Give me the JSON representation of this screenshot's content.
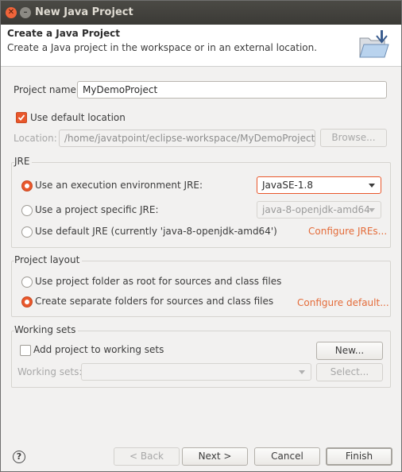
{
  "window": {
    "title": "New Java Project"
  },
  "banner": {
    "title": "Create a Java Project",
    "description": "Create a Java project in the workspace or in an external location.",
    "icon": "folder-wizard-icon"
  },
  "project_name": {
    "label": "Project name:",
    "value": "MyDemoProject"
  },
  "use_default_location": {
    "label": "Use default location",
    "checked": true
  },
  "location": {
    "label": "Location:",
    "value": "/home/javatpoint/eclipse-workspace/MyDemoProject",
    "browse_label": "Browse..."
  },
  "jre": {
    "group_title": "JRE",
    "options": [
      {
        "label": "Use an execution environment JRE:",
        "selected": true
      },
      {
        "label": "Use a project specific JRE:",
        "selected": false
      },
      {
        "label": "Use default JRE (currently 'java-8-openjdk-amd64')",
        "selected": false
      }
    ],
    "execution_env_value": "JavaSE-1.8",
    "project_specific_value": "java-8-openjdk-amd64",
    "configure_link": "Configure JREs..."
  },
  "layout": {
    "group_title": "Project layout",
    "options": [
      {
        "label": "Use project folder as root for sources and class files",
        "selected": false
      },
      {
        "label": "Create separate folders for sources and class files",
        "selected": true
      }
    ],
    "configure_link": "Configure default..."
  },
  "working_sets": {
    "group_title": "Working sets",
    "add_label": "Add project to working sets",
    "add_checked": false,
    "new_label": "New...",
    "sets_label": "Working sets:",
    "sets_value": "",
    "select_label": "Select..."
  },
  "footer": {
    "help": "?",
    "back": "< Back",
    "next": "Next >",
    "cancel": "Cancel",
    "finish": "Finish"
  },
  "colors": {
    "accent": "#e9572b",
    "link": "#e46c3a",
    "titlebar": "#3e3d39"
  }
}
